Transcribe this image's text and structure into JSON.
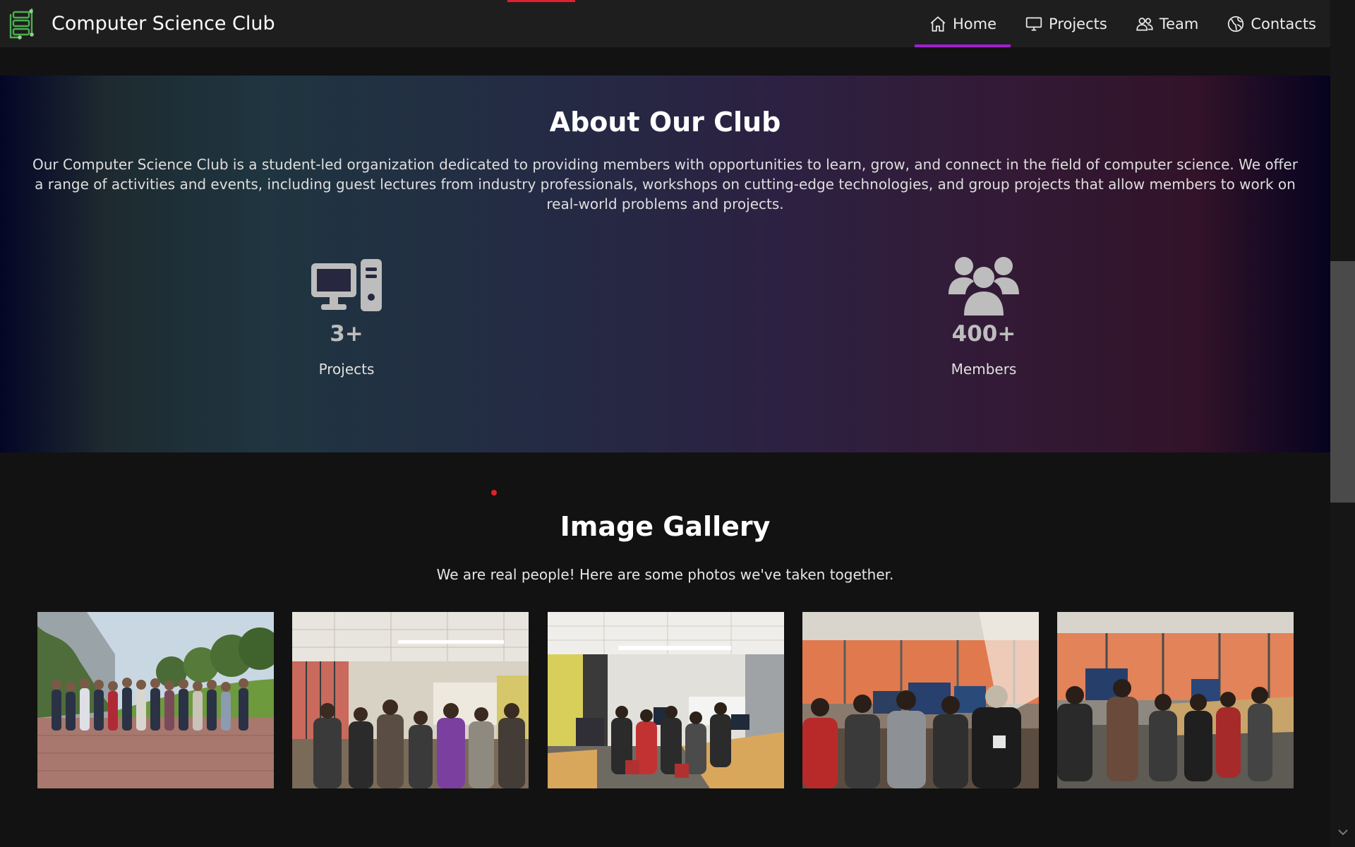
{
  "header": {
    "brand_title": "Computer Science Club",
    "nav": [
      {
        "label": "Home",
        "icon": "home-icon",
        "active": true
      },
      {
        "label": "Projects",
        "icon": "monitor-icon"
      },
      {
        "label": "Team",
        "icon": "people-icon"
      },
      {
        "label": "Contacts",
        "icon": "globe-icon"
      }
    ]
  },
  "about": {
    "title": "About Our Club",
    "description": "Our Computer Science Club is a student-led organization dedicated to providing members with opportunities to learn, grow, and connect in the field of computer science. We offer a range of activities and events, including guest lectures from industry professionals, workshops on cutting-edge technologies, and group projects that allow members to work on real-world problems and projects.",
    "stats": [
      {
        "value": "3+",
        "label": "Projects",
        "icon": "desktop-computer-icon"
      },
      {
        "value": "400+",
        "label": "Members",
        "icon": "users-group-icon"
      }
    ]
  },
  "gallery": {
    "title": "Image Gallery",
    "subtitle": "We are real people! Here are some photos we've taken together.",
    "photos": [
      "group-photo-outdoors",
      "classroom-meeting-photo",
      "lab-session-photo",
      "students-at-computers-photo",
      "computer-lab-photo"
    ]
  },
  "colors": {
    "accent": "#a21fd0",
    "indicator": "#e0212b",
    "navbar": "#1e1e1e",
    "page_bg": "#121212"
  }
}
